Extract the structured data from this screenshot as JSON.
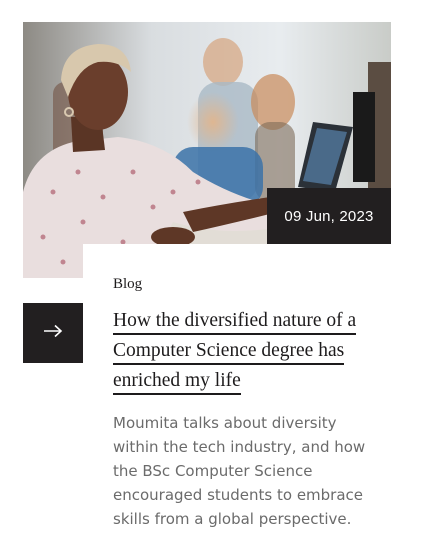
{
  "card": {
    "image_alt": "Student working on a laptop in a computer lab",
    "date": "09 Jun, 2023",
    "category": "Blog",
    "title": "How the diversified nature of a Computer Science degree has enriched my life",
    "excerpt": "Moumita talks about diversity within the tech industry, and how the BSc Computer Science encouraged students to embrace skills from a global perspective.",
    "arrow_icon": "arrow-right-icon"
  },
  "colors": {
    "dark": "#221f20",
    "text": "#1d1b1c",
    "muted": "#6b6b6b"
  }
}
